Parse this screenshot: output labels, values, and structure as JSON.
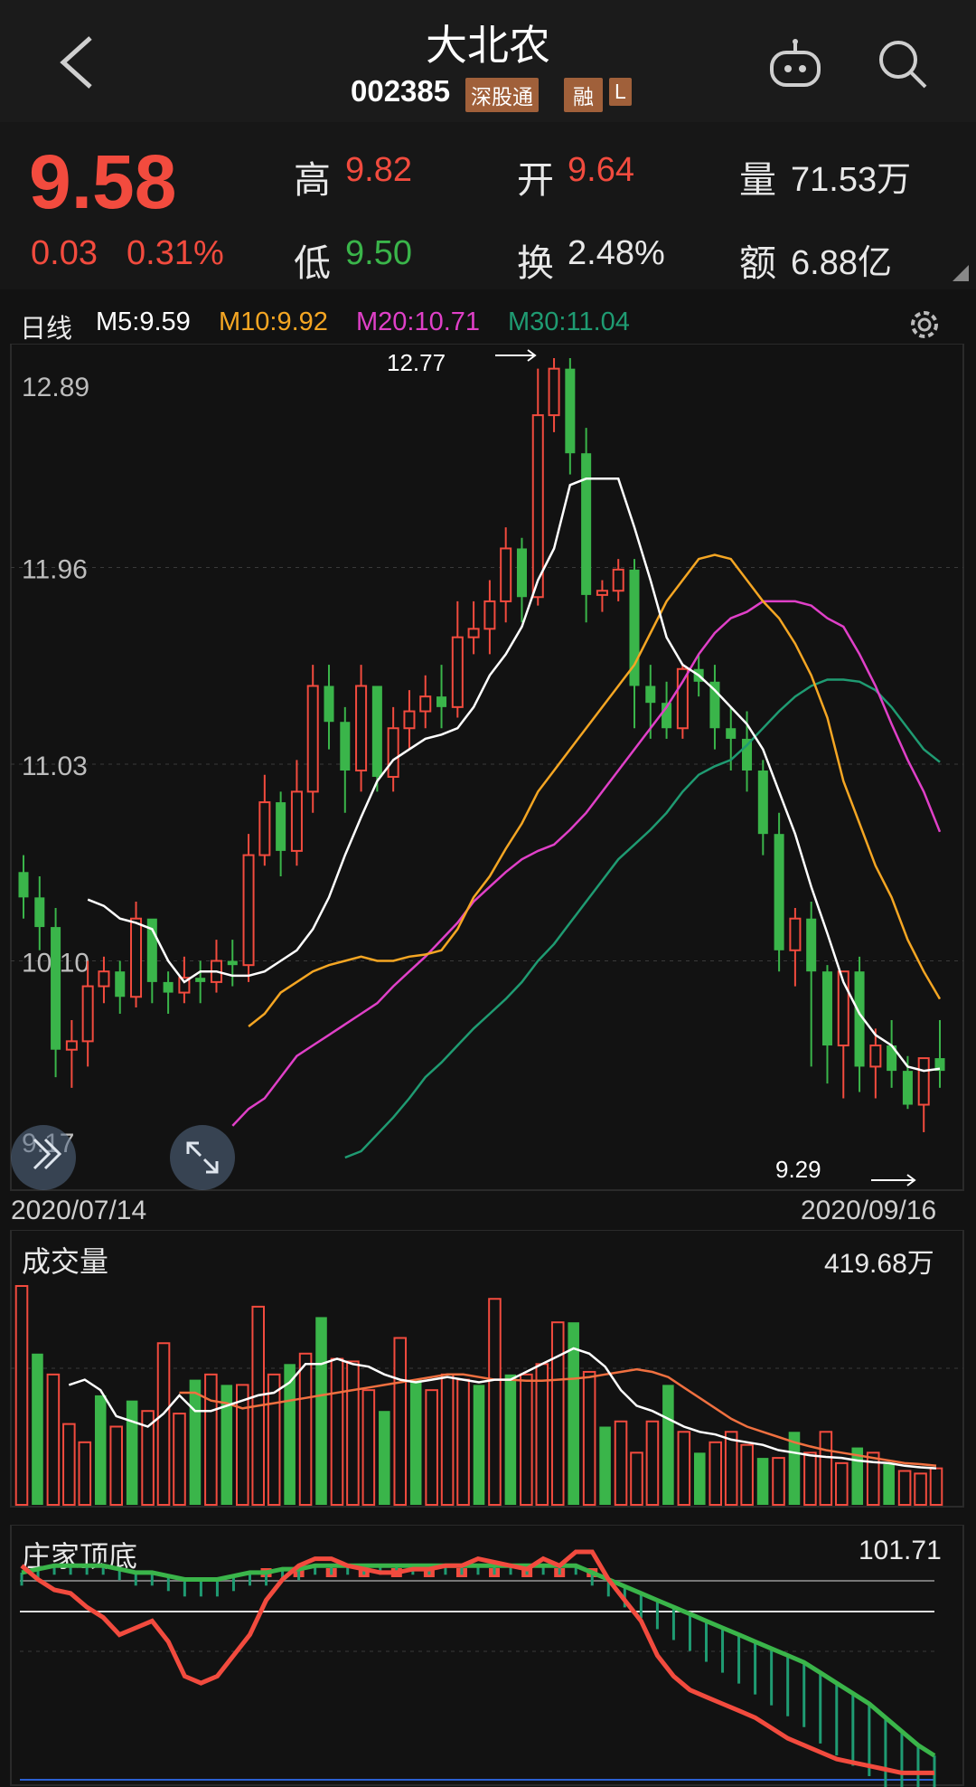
{
  "header": {
    "title": "大北农",
    "code": "002385",
    "tag_connect": "深股通",
    "tag_margin": "融",
    "tag_level": "L"
  },
  "quote": {
    "price": "9.58",
    "change": "0.03",
    "change_pct": "0.31%",
    "high_label": "高",
    "high": "9.82",
    "low_label": "低",
    "low": "9.50",
    "open_label": "开",
    "open": "9.64",
    "turnover_label": "换",
    "turnover": "2.48%",
    "volume_label": "量",
    "volume": "71.53万",
    "amount_label": "额",
    "amount": "6.88亿"
  },
  "colors": {
    "up": "#f24b3e",
    "down": "#3ab54a",
    "ma5": "#ffffff",
    "ma10": "#f5a623",
    "ma20": "#e040c8",
    "ma30": "#1f9b72"
  },
  "kline": {
    "period": "日线",
    "ma5": "M5:9.59",
    "ma10": "M10:9.92",
    "ma20": "M20:10.71",
    "ma30": "M30:11.04",
    "y_ticks": [
      "12.89",
      "11.96",
      "11.03",
      "10.10",
      "9.17"
    ],
    "high_mark": "12.77",
    "low_mark": "9.29",
    "start_date": "2020/07/14",
    "end_date": "2020/09/16"
  },
  "volume_panel": {
    "title": "成交量",
    "max": "419.68万"
  },
  "indicator_panel": {
    "title": "庄家顶底",
    "value": "101.71"
  },
  "chart_data": [
    {
      "type": "candlestick",
      "title": "日线",
      "x_start": "2020/07/14",
      "x_end": "2020/09/16",
      "ylim": [
        9.17,
        12.89
      ],
      "y_ticks": [
        12.89,
        11.96,
        11.03,
        10.1,
        9.17
      ],
      "open": [
        10.52,
        10.4,
        10.26,
        9.68,
        9.72,
        9.98,
        10.05,
        9.93,
        10.3,
        10.0,
        9.95,
        10.02,
        10.0,
        10.1,
        10.08,
        10.6,
        10.85,
        10.62,
        10.9,
        11.4,
        11.23,
        11.0,
        11.4,
        10.97,
        11.2,
        11.28,
        11.35,
        11.3,
        11.63,
        11.67,
        11.8,
        12.05,
        11.82,
        12.68,
        12.9,
        12.5,
        11.83,
        11.85,
        11.95,
        11.4,
        11.32,
        11.2,
        11.48,
        11.42,
        11.2,
        11.15,
        11.0,
        10.7,
        10.15,
        10.3,
        10.05,
        9.7,
        10.05,
        9.6,
        9.7,
        9.58,
        9.42,
        9.64
      ],
      "close": [
        10.4,
        10.26,
        9.68,
        9.72,
        9.98,
        10.05,
        9.93,
        10.3,
        10.0,
        9.95,
        10.02,
        10.0,
        10.1,
        10.08,
        10.6,
        10.85,
        10.62,
        10.9,
        11.4,
        11.23,
        11.0,
        11.4,
        10.97,
        11.2,
        11.28,
        11.35,
        11.3,
        11.63,
        11.67,
        11.8,
        12.05,
        11.82,
        12.68,
        12.9,
        12.5,
        11.83,
        11.85,
        11.95,
        11.4,
        11.32,
        11.2,
        11.48,
        11.42,
        11.2,
        11.15,
        11.0,
        10.7,
        10.15,
        10.3,
        10.05,
        9.7,
        10.05,
        9.6,
        9.7,
        9.58,
        9.42,
        9.64,
        9.58
      ],
      "high": [
        10.6,
        10.5,
        10.35,
        9.82,
        10.1,
        10.12,
        10.1,
        10.38,
        10.1,
        10.05,
        10.12,
        10.1,
        10.2,
        10.2,
        10.7,
        10.98,
        10.9,
        11.05,
        11.5,
        11.5,
        11.3,
        11.5,
        11.4,
        11.3,
        11.38,
        11.45,
        11.5,
        11.8,
        11.8,
        11.9,
        12.15,
        12.1,
        12.9,
        12.95,
        12.95,
        12.62,
        11.9,
        12.0,
        12.0,
        11.5,
        11.42,
        11.5,
        11.55,
        11.5,
        11.3,
        11.28,
        11.05,
        10.8,
        10.35,
        10.38,
        10.08,
        9.8,
        10.12,
        9.78,
        9.82,
        9.65,
        9.5,
        9.82
      ],
      "low": [
        10.3,
        10.15,
        9.55,
        9.5,
        9.6,
        9.9,
        9.85,
        9.88,
        9.9,
        9.85,
        9.9,
        9.9,
        9.95,
        9.98,
        10.0,
        10.55,
        10.5,
        10.55,
        10.8,
        11.1,
        10.8,
        10.9,
        10.9,
        10.9,
        11.1,
        11.2,
        11.2,
        11.25,
        11.55,
        11.55,
        11.7,
        11.7,
        11.78,
        12.6,
        12.4,
        11.7,
        11.75,
        11.8,
        11.2,
        11.15,
        11.15,
        11.15,
        11.35,
        11.1,
        11.0,
        10.9,
        10.6,
        10.05,
        9.98,
        9.6,
        9.52,
        9.45,
        9.48,
        9.45,
        9.5,
        9.4,
        9.29,
        9.5
      ],
      "ma5": [
        10.39,
        10.36,
        10.3,
        10.28,
        10.25,
        10.1,
        10.0,
        10.05,
        10.05,
        10.03,
        10.03,
        10.05,
        10.1,
        10.15,
        10.25,
        10.4,
        10.6,
        10.78,
        10.95,
        11.05,
        11.1,
        11.15,
        11.17,
        11.2,
        11.3,
        11.45,
        11.55,
        11.68,
        11.9,
        12.05,
        12.35,
        12.38,
        12.38,
        12.38,
        12.15,
        11.9,
        11.63,
        11.5,
        11.45,
        11.38,
        11.3,
        11.22,
        11.1,
        10.9,
        10.7,
        10.45,
        10.23,
        10.0,
        9.85,
        9.75,
        9.7,
        9.6,
        9.58,
        9.59
      ],
      "ma10": [
        9.79,
        9.85,
        9.95,
        10.0,
        10.05,
        10.08,
        10.1,
        10.12,
        10.1,
        10.1,
        10.12,
        10.13,
        10.15,
        10.25,
        10.4,
        10.5,
        10.63,
        10.75,
        10.9,
        11.0,
        11.1,
        11.2,
        11.3,
        11.4,
        11.5,
        11.65,
        11.8,
        11.9,
        12.0,
        12.02,
        12.0,
        11.9,
        11.8,
        11.72,
        11.6,
        11.45,
        11.25,
        10.95,
        10.75,
        10.55,
        10.4,
        10.2,
        10.05,
        9.92
      ],
      "ma20": [
        9.32,
        9.4,
        9.45,
        9.55,
        9.65,
        9.7,
        9.75,
        9.8,
        9.85,
        9.9,
        9.98,
        10.05,
        10.12,
        10.2,
        10.28,
        10.38,
        10.45,
        10.52,
        10.58,
        10.62,
        10.65,
        10.72,
        10.8,
        10.9,
        11.0,
        11.1,
        11.2,
        11.3,
        11.42,
        11.55,
        11.65,
        11.72,
        11.75,
        11.8,
        11.8,
        11.8,
        11.78,
        11.72,
        11.68,
        11.55,
        11.4,
        11.22,
        11.05,
        10.9,
        10.71
      ],
      "ma30": [
        9.17,
        9.2,
        9.28,
        9.36,
        9.45,
        9.55,
        9.62,
        9.7,
        9.78,
        9.85,
        9.92,
        10.0,
        10.1,
        10.18,
        10.28,
        10.38,
        10.48,
        10.58,
        10.65,
        10.72,
        10.8,
        10.9,
        10.98,
        11.02,
        11.05,
        11.12,
        11.2,
        11.28,
        11.35,
        11.4,
        11.43,
        11.43,
        11.42,
        11.38,
        11.3,
        11.2,
        11.1,
        11.04
      ]
    },
    {
      "type": "bar",
      "title": "成交量",
      "unit": "万",
      "ylim": [
        0,
        419.68
      ],
      "values": [
        419.68,
        290,
        250,
        155,
        120,
        210,
        150,
        200,
        180,
        310,
        175,
        240,
        250,
        230,
        230,
        380,
        250,
        270,
        290,
        360,
        280,
        275,
        220,
        180,
        320,
        240,
        220,
        250,
        240,
        230,
        395,
        250,
        250,
        270,
        350,
        350,
        255,
        150,
        160,
        100,
        160,
        230,
        140,
        100,
        120,
        140,
        115,
        90,
        90,
        140,
        100,
        140,
        80,
        110,
        100,
        78,
        65,
        60,
        70
      ],
      "ma5": [
        230,
        240,
        220,
        170,
        160,
        150,
        175,
        210,
        180,
        180,
        190,
        200,
        210,
        215,
        235,
        270,
        270,
        280,
        270,
        265,
        250,
        240,
        235,
        240,
        245,
        240,
        235,
        240,
        240,
        255,
        270,
        285,
        300,
        290,
        265,
        220,
        190,
        180,
        165,
        150,
        140,
        135,
        125,
        120,
        115,
        105,
        100,
        95,
        92,
        90,
        85,
        82,
        80,
        75,
        72,
        70
      ],
      "ma10": [
        215,
        215,
        200,
        195,
        185,
        190,
        195,
        200,
        205,
        210,
        215,
        220,
        225,
        230,
        235,
        240,
        245,
        250,
        250,
        245,
        240,
        240,
        238,
        238,
        240,
        242,
        245,
        250,
        255,
        260,
        255,
        245,
        225,
        205,
        185,
        165,
        150,
        140,
        130,
        120,
        112,
        105,
        100,
        95,
        90,
        85,
        80,
        78,
        75
      ]
    },
    {
      "type": "line",
      "title": "庄家顶底",
      "value": 101.71,
      "red_line": [
        62,
        58,
        55,
        54,
        50,
        47,
        42,
        44,
        46,
        40,
        30,
        28,
        30,
        36,
        42,
        52,
        58,
        62,
        64,
        64,
        62,
        61,
        60,
        60,
        61,
        61,
        62,
        62,
        64,
        63,
        62,
        61,
        64,
        62,
        66,
        66,
        58,
        52,
        46,
        36,
        30,
        26,
        24,
        22,
        20,
        18,
        15,
        12,
        10,
        8,
        6,
        5,
        4,
        3,
        2,
        2,
        2
      ],
      "green_line": [
        60,
        61,
        62,
        62,
        62,
        62,
        61,
        60,
        60,
        59,
        58,
        58,
        58,
        59,
        60,
        60,
        61,
        61,
        62,
        62,
        62,
        62,
        62,
        62,
        62,
        62,
        62,
        62,
        62,
        62,
        62,
        62,
        62,
        62,
        62,
        60,
        58,
        56,
        54,
        52,
        50,
        48,
        46,
        44,
        42,
        40,
        38,
        36,
        34,
        31,
        28,
        25,
        22,
        18,
        14,
        10,
        7
      ]
    }
  ]
}
